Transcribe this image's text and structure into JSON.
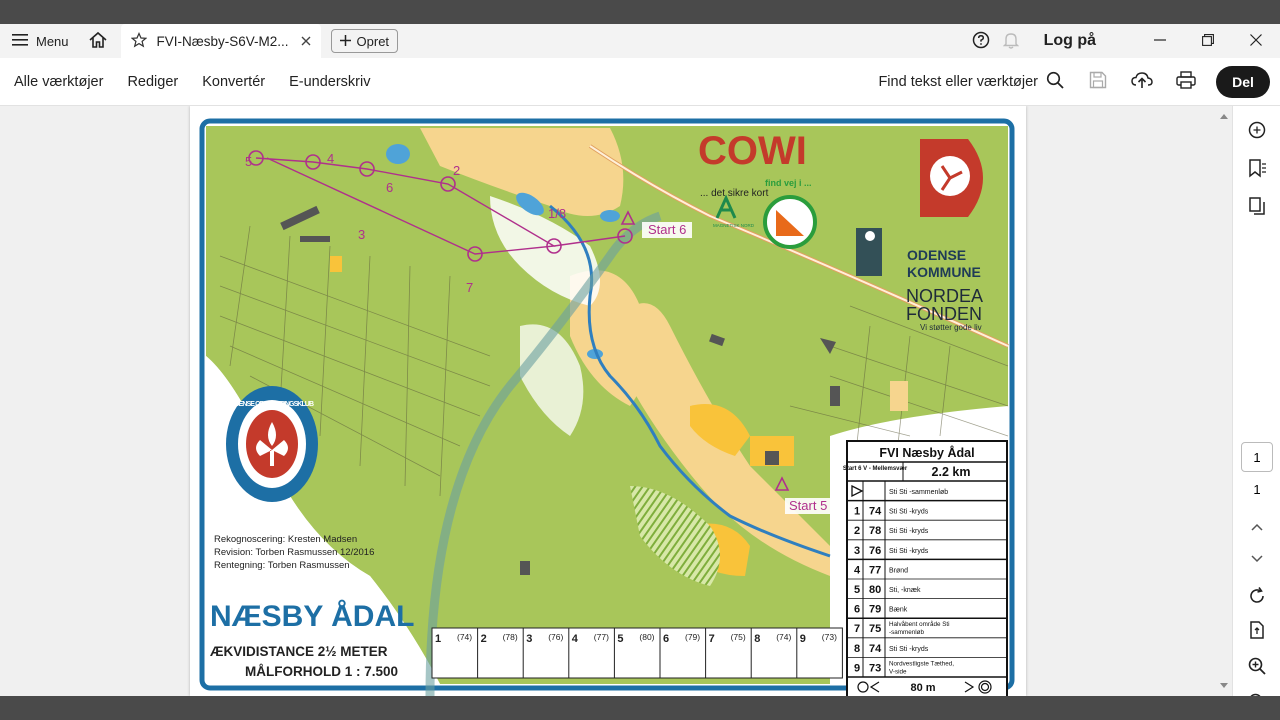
{
  "tabbar": {
    "menu_label": "Menu",
    "tab_title": "FVI-Næsby-S6V-M2...",
    "create_label": "Opret",
    "login_label": "Log på"
  },
  "toolbar": {
    "tools": [
      "Alle værktøjer",
      "Rediger",
      "Konvertér",
      "E-underskriv"
    ],
    "find_label": "Find tekst eller værktøjer",
    "share_label": "Del"
  },
  "pagenav": {
    "current": "1",
    "total": "1"
  },
  "map": {
    "sponsor_cowi": "COWI",
    "sponsor_cowi_tag": "... det sikre kort",
    "magnetic_north": "MAGNETISK NORD",
    "findvej": "find vej i ...",
    "odense_line1": "ODENSE",
    "odense_line2": "KOMMUNE",
    "nordea_line1": "NORDEA",
    "nordea_line2": "FONDEN",
    "nordea_tag": "Vi støtter gode liv",
    "club_ring": "ODENSE ORIENTERINGSKLUB",
    "credits": [
      "Rekognoscering: Kresten Madsen",
      "Revision: Torben Rasmussen 12/2016",
      "Rentegning: Torben Rasmussen"
    ],
    "map_title": "NÆSBY ÅDAL",
    "contour": "ÆKVIDISTANCE 2½ METER",
    "scale": "MÅLFORHOLD 1 : 7.500",
    "start6_label": "Start 6",
    "start5_label": "Start 5",
    "control_labels": [
      "1/8",
      "2",
      "3",
      "4",
      "5",
      "6",
      "7"
    ],
    "course_title": "FVI Næsby Ådal",
    "course_sub": "Start 6 V - Mellemsvær",
    "course_length": "2.2 km",
    "start_desc": "Sti Sti -sammenløb",
    "controls": [
      {
        "num": "1",
        "code": "74",
        "desc": "Sti Sti -kryds"
      },
      {
        "num": "2",
        "code": "78",
        "desc": "Sti Sti -kryds"
      },
      {
        "num": "3",
        "code": "76",
        "desc": "Sti Sti -kryds"
      },
      {
        "num": "4",
        "code": "77",
        "desc": "Brønd"
      },
      {
        "num": "5",
        "code": "80",
        "desc": "Sti, -knæk"
      },
      {
        "num": "6",
        "code": "79",
        "desc": "Bænk"
      },
      {
        "num": "7",
        "code": "75",
        "desc": "Halvåbent område Sti -sammenløb"
      },
      {
        "num": "8",
        "code": "74",
        "desc": "Sti Sti -kryds"
      },
      {
        "num": "9",
        "code": "73",
        "desc": "Nordvestligste Tæthed, V-side"
      }
    ],
    "finish_distance": "80 m",
    "punch_boxes": [
      {
        "num": "1",
        "code": "(74)"
      },
      {
        "num": "2",
        "code": "(78)"
      },
      {
        "num": "3",
        "code": "(76)"
      },
      {
        "num": "4",
        "code": "(77)"
      },
      {
        "num": "5",
        "code": "(80)"
      },
      {
        "num": "6",
        "code": "(79)"
      },
      {
        "num": "7",
        "code": "(75)"
      },
      {
        "num": "8",
        "code": "(74)"
      },
      {
        "num": "9",
        "code": "(73)"
      }
    ]
  },
  "colors": {
    "map_frame": "#1d6fa5",
    "forest": "#a8c65a",
    "open": "#f6d58e",
    "course": "#b0308c",
    "water": "#4fa3d8"
  }
}
